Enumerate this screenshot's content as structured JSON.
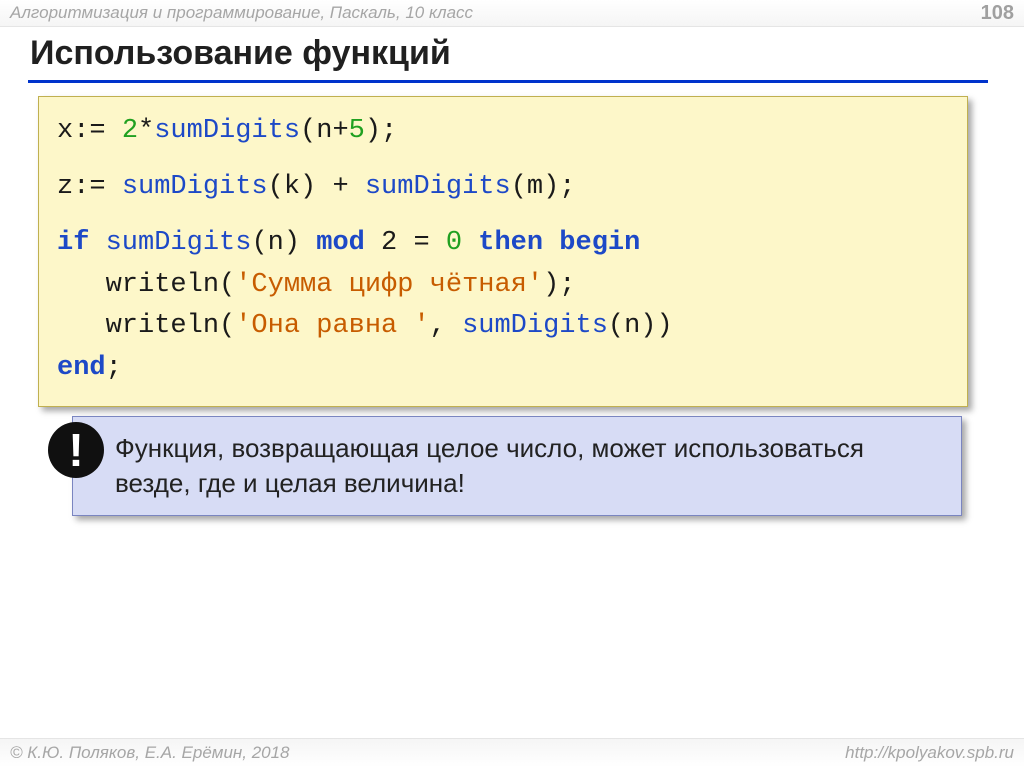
{
  "header": {
    "course": "Алгоритмизация и программирование, Паскаль, 10 класс",
    "page": "108"
  },
  "title": "Использование функций",
  "code": {
    "line1": {
      "t1": "x:= ",
      "n1": "2",
      "t2": "*",
      "fn1": "sumDigits",
      "t3": "(n+",
      "n2": "5",
      "t4": ");"
    },
    "line2": {
      "t1": "z:= ",
      "fn1": "sumDigits",
      "t2": "(k) + ",
      "fn2": "sumDigits",
      "t3": "(m);"
    },
    "line3": {
      "kw1": "if",
      "sp1": " ",
      "fn1": "sumDigits",
      "t1": "(n) ",
      "kw2": "mod",
      "t2": " 2 = ",
      "n1": "0",
      "sp2": " ",
      "kw3": "then",
      "sp3": " ",
      "kw4": "begin"
    },
    "line4": {
      "pad": "   writeln(",
      "s": "'Сумма цифр чётная'",
      "t": ");"
    },
    "line5": {
      "pad": "   writeln(",
      "s": "'Она равна '",
      "t1": ", ",
      "fn": "sumDigits",
      "t2": "(n))"
    },
    "line6": {
      "kw": "end",
      "t": ";"
    }
  },
  "callout": {
    "badge": "!",
    "text": "Функция, возвращающая целое число, может использоваться везде, где и целая величина!"
  },
  "footer": {
    "author": "© К.Ю. Поляков, Е.А. Ерёмин, 2018",
    "url": "http://kpolyakov.spb.ru"
  }
}
